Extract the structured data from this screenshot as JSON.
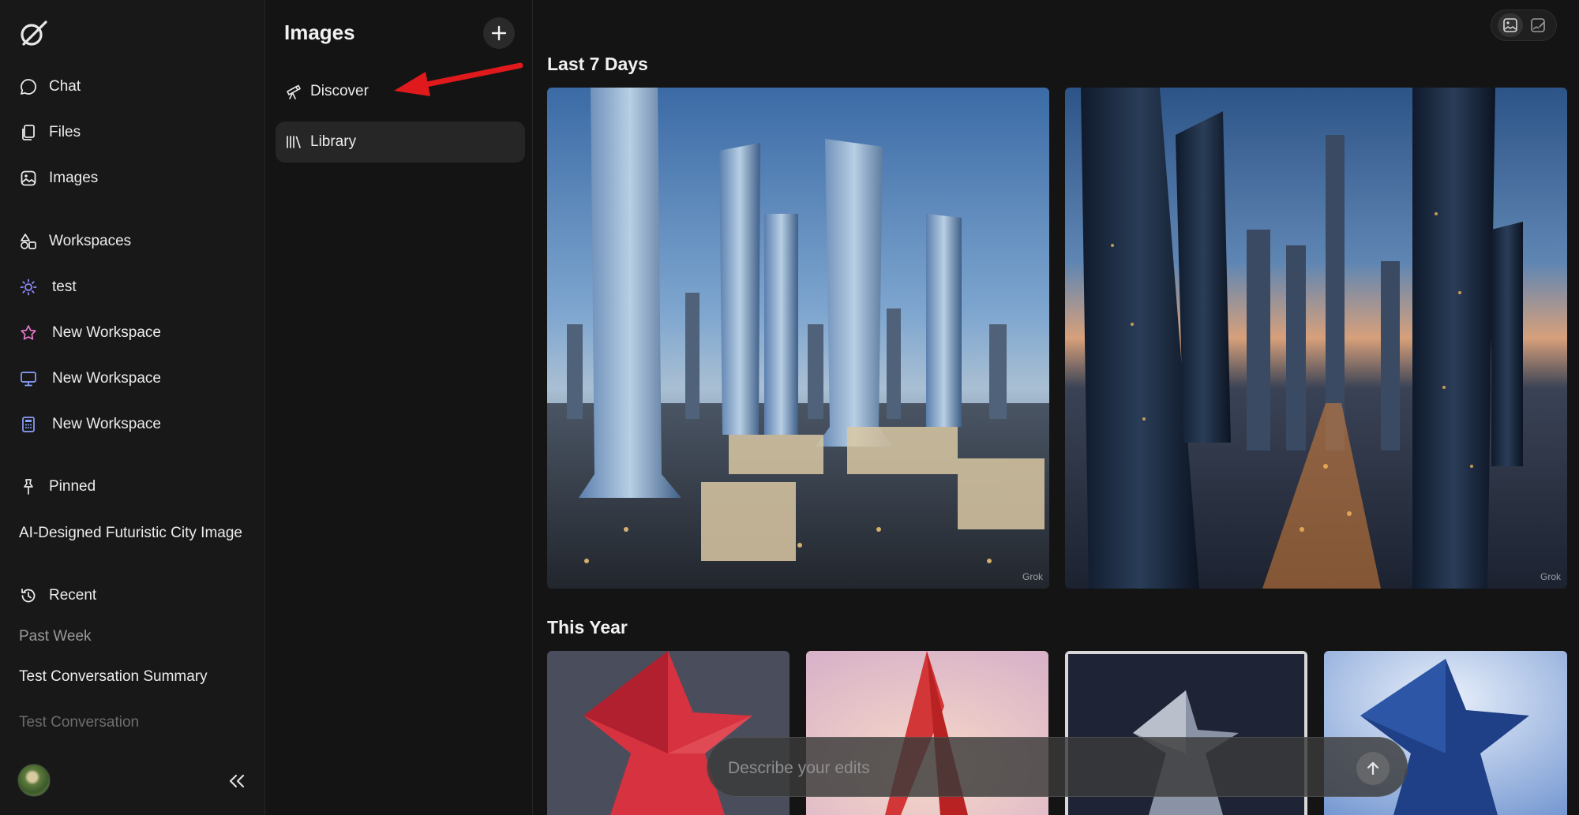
{
  "sidebar": {
    "nav": [
      {
        "label": "Chat",
        "icon": "chat-bubble-icon"
      },
      {
        "label": "Files",
        "icon": "files-icon"
      },
      {
        "label": "Images",
        "icon": "image-icon"
      }
    ],
    "workspaces_header": {
      "label": "Workspaces",
      "icon": "shapes-icon"
    },
    "workspaces": [
      {
        "label": "test",
        "icon": "sun-icon",
        "color": "#8f8cff"
      },
      {
        "label": "New Workspace",
        "icon": "star-icon",
        "color": "#e879c9"
      },
      {
        "label": "New Workspace",
        "icon": "monitor-icon",
        "color": "#8aa0ff"
      },
      {
        "label": "New Workspace",
        "icon": "calculator-icon",
        "color": "#8aa0ff"
      }
    ],
    "pinned_header": {
      "label": "Pinned",
      "icon": "pin-icon"
    },
    "pinned": [
      "AI-Designed Futuristic City Image"
    ],
    "recent_header": {
      "label": "Recent",
      "icon": "history-icon"
    },
    "recent_group": "Past Week",
    "recent": [
      "Test Conversation Summary",
      "Test Conversation"
    ]
  },
  "panel": {
    "title": "Images",
    "items": [
      {
        "label": "Discover",
        "icon": "telescope-icon"
      },
      {
        "label": "Library",
        "icon": "library-icon"
      }
    ]
  },
  "main": {
    "section_recent": "Last 7 Days",
    "section_year": "This Year",
    "watermark": "Grok"
  },
  "prompt": {
    "placeholder": "Describe your edits"
  },
  "colors": {
    "annotation_arrow": "#e0191c",
    "accent_workspace": "#8f8cff"
  }
}
